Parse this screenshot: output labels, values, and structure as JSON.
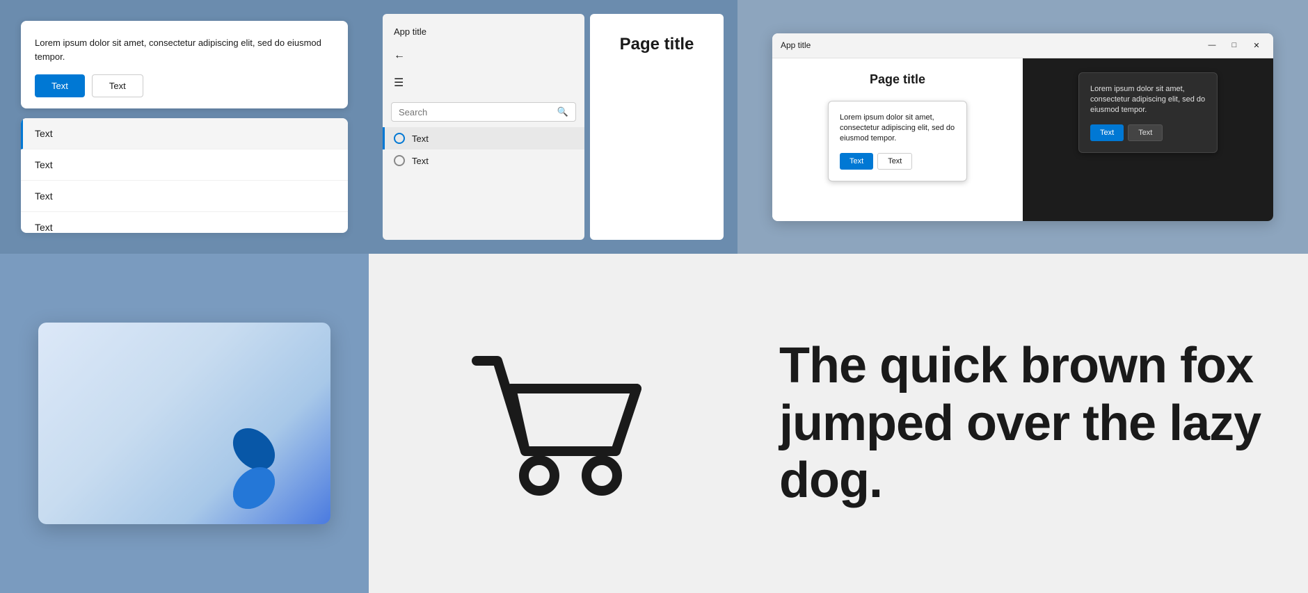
{
  "topLeft": {
    "dialog": {
      "text": "Lorem ipsum dolor sit amet, consectetur adipiscing elit, sed do eiusmod tempor.",
      "primaryBtn": "Text",
      "secondaryBtn": "Text"
    },
    "list": {
      "items": [
        {
          "label": "Text",
          "selected": true
        },
        {
          "label": "Text",
          "selected": false
        },
        {
          "label": "Text",
          "selected": false
        },
        {
          "label": "Text",
          "selected": false
        }
      ]
    }
  },
  "topCenter": {
    "nav": {
      "appTitle": "App title",
      "search": {
        "placeholder": "Search"
      },
      "items": [
        {
          "label": "Text",
          "active": true
        },
        {
          "label": "Text",
          "active": false
        }
      ]
    },
    "page": {
      "title": "Page title"
    }
  },
  "topRight": {
    "window": {
      "title": "App title",
      "controls": {
        "minimize": "—",
        "maximize": "□",
        "close": "✕"
      },
      "lightSide": {
        "pageTitle": "Page title",
        "dialog": {
          "text": "Lorem ipsum dolor sit amet, consectetur adipiscing elit, sed do eiusmod tempor.",
          "primaryBtn": "Text",
          "secondaryBtn": "Text"
        }
      },
      "darkSide": {
        "dialog": {
          "text": "Lorem ipsum dolor sit amet, consectetur adipiscing elit, sed do eiusmod tempor.",
          "primaryBtn": "Text",
          "secondaryBtn": "Text"
        }
      }
    }
  },
  "bottomRight": {
    "text": "The quick brown fox jumped over the lazy dog."
  }
}
